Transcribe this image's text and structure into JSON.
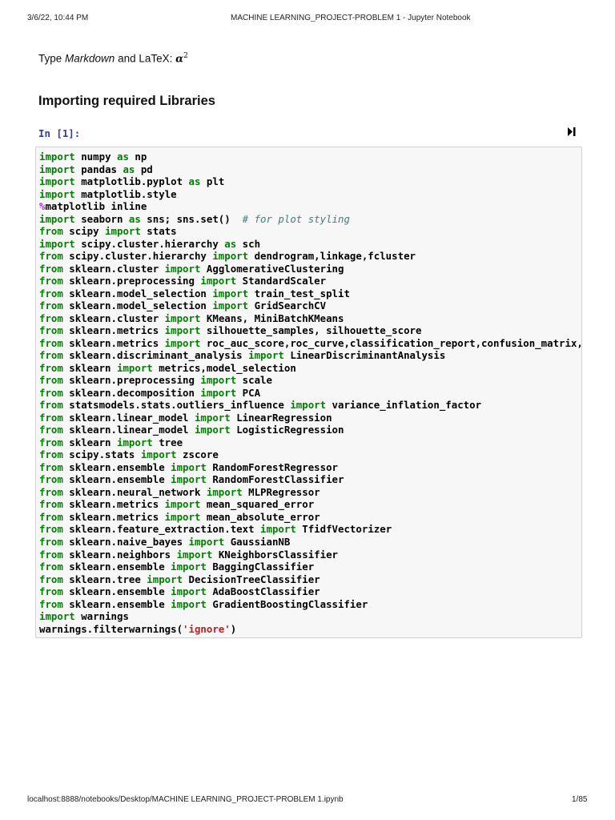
{
  "header": {
    "datetime": "3/6/22, 10:44 PM",
    "title": "MACHINE LEARNING_PROJECT-PROBLEM 1 - Jupyter Notebook"
  },
  "markdown": {
    "prefix": "Type ",
    "italic": "Markdown",
    "middle": " and LaTeX: ",
    "math": "α",
    "sup": "2"
  },
  "heading": "Importing required Libraries",
  "cell": {
    "prompt": "In [1]:",
    "run_icon": "run-cell-icon",
    "lines": [
      "import numpy as np",
      "import pandas as pd",
      "import matplotlib.pyplot as plt",
      "import matplotlib.style",
      "%matplotlib inline",
      "import seaborn as sns; sns.set()  # for plot styling",
      "from scipy import stats",
      "import scipy.cluster.hierarchy as sch",
      "from scipy.cluster.hierarchy import dendrogram,linkage,fcluster",
      "from sklearn.cluster import AgglomerativeClustering",
      "from sklearn.preprocessing import StandardScaler",
      "from sklearn.model_selection import train_test_split",
      "from sklearn.model_selection import GridSearchCV",
      "from sklearn.cluster import KMeans, MiniBatchKMeans",
      "from sklearn.metrics import silhouette_samples, silhouette_score",
      "from sklearn.metrics import roc_auc_score,roc_curve,classification_report,confusion_matrix,",
      "from sklearn.discriminant_analysis import LinearDiscriminantAnalysis",
      "from sklearn import metrics,model_selection",
      "from sklearn.preprocessing import scale",
      "from sklearn.decomposition import PCA",
      "from statsmodels.stats.outliers_influence import variance_inflation_factor",
      "from sklearn.linear_model import LinearRegression",
      "from sklearn.linear_model import LogisticRegression",
      "from sklearn import tree",
      "from scipy.stats import zscore",
      "from sklearn.ensemble import RandomForestRegressor",
      "from sklearn.ensemble import RandomForestClassifier",
      "from sklearn.neural_network import MLPRegressor",
      "from sklearn.metrics import mean_squared_error",
      "from sklearn.metrics import mean_absolute_error",
      "from sklearn.feature_extraction.text import TfidfVectorizer",
      "from sklearn.naive_bayes import GaussianNB",
      "from sklearn.neighbors import KNeighborsClassifier",
      "from sklearn.ensemble import BaggingClassifier",
      "from sklearn.tree import DecisionTreeClassifier",
      "from sklearn.ensemble import AdaBoostClassifier",
      "from sklearn.ensemble import GradientBoostingClassifier",
      "import warnings",
      "warnings.filterwarnings('ignore')"
    ]
  },
  "footer": {
    "url": "localhost:8888/notebooks/Desktop/MACHINE LEARNING_PROJECT-PROBLEM 1.ipynb",
    "page": "1/85"
  }
}
